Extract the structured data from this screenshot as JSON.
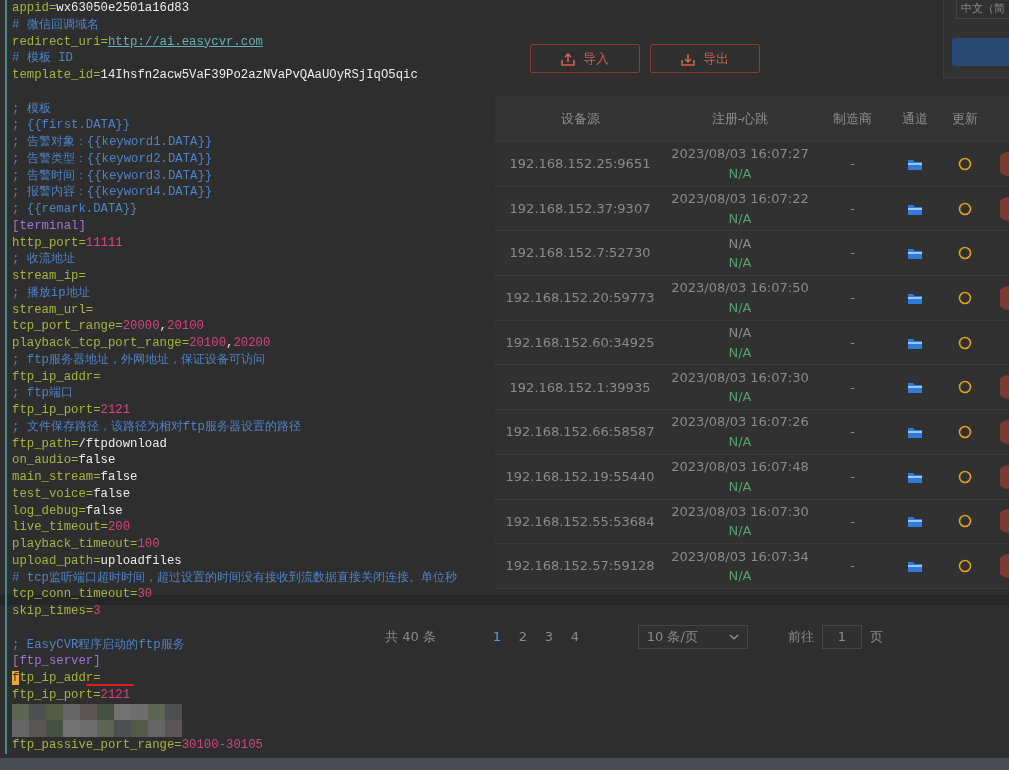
{
  "editor": {
    "lines": [
      {
        "kind": "code",
        "tokens": [
          {
            "kind": "key",
            "text": "appid="
          },
          {
            "kind": "value",
            "text": "wx63050e2501a16d83"
          }
        ]
      },
      {
        "kind": "code",
        "tokens": [
          {
            "kind": "comment",
            "text": "# 微信回调域名"
          }
        ]
      },
      {
        "kind": "code",
        "tokens": [
          {
            "kind": "key",
            "text": "redirect_uri="
          },
          {
            "kind": "url",
            "text": "http://ai.easycvr.com"
          }
        ]
      },
      {
        "kind": "code",
        "tokens": [
          {
            "kind": "comment",
            "text": "# 模板 ID"
          }
        ]
      },
      {
        "kind": "code",
        "tokens": [
          {
            "kind": "key",
            "text": "template_id="
          },
          {
            "kind": "value",
            "text": "14Ihsfn2acw5VaF39Po2azNVaPvQAaUOyRSjIqO5qic"
          }
        ]
      },
      {
        "kind": "blank"
      },
      {
        "kind": "code",
        "tokens": [
          {
            "kind": "comment",
            "text": "; 模板"
          }
        ]
      },
      {
        "kind": "code",
        "tokens": [
          {
            "kind": "comment",
            "text": "; {{first.DATA}}"
          }
        ]
      },
      {
        "kind": "code",
        "tokens": [
          {
            "kind": "comment",
            "text": "; 告警对象：{{keyword1.DATA}}"
          }
        ]
      },
      {
        "kind": "code",
        "tokens": [
          {
            "kind": "comment",
            "text": "; 告警类型：{{keyword2.DATA}}"
          }
        ]
      },
      {
        "kind": "code",
        "tokens": [
          {
            "kind": "comment",
            "text": "; 告警时间：{{keyword3.DATA}}"
          }
        ]
      },
      {
        "kind": "code",
        "tokens": [
          {
            "kind": "comment",
            "text": "; 报警内容：{{keyword4.DATA}}"
          }
        ]
      },
      {
        "kind": "code",
        "tokens": [
          {
            "kind": "comment",
            "text": "; {{remark.DATA}}"
          }
        ]
      },
      {
        "kind": "code",
        "tokens": [
          {
            "kind": "section",
            "text": "[terminal]"
          }
        ]
      },
      {
        "kind": "code",
        "tokens": [
          {
            "kind": "key",
            "text": "http_port="
          },
          {
            "kind": "number",
            "text": "11111"
          }
        ]
      },
      {
        "kind": "code",
        "tokens": [
          {
            "kind": "comment",
            "text": "; 收流地址"
          }
        ]
      },
      {
        "kind": "code",
        "tokens": [
          {
            "kind": "key",
            "text": "stream_ip="
          }
        ]
      },
      {
        "kind": "code",
        "tokens": [
          {
            "kind": "comment",
            "text": "; 播放ip地址"
          }
        ]
      },
      {
        "kind": "code",
        "tokens": [
          {
            "kind": "key",
            "text": "stream_url="
          }
        ]
      },
      {
        "kind": "code",
        "tokens": [
          {
            "kind": "key",
            "text": "tcp_port_range="
          },
          {
            "kind": "number",
            "text": "20000"
          },
          {
            "kind": "value",
            "text": ","
          },
          {
            "kind": "number",
            "text": "20100"
          }
        ]
      },
      {
        "kind": "code",
        "tokens": [
          {
            "kind": "key",
            "text": "playback_tcp_port_range="
          },
          {
            "kind": "number",
            "text": "20100"
          },
          {
            "kind": "value",
            "text": ","
          },
          {
            "kind": "number",
            "text": "20200"
          }
        ]
      },
      {
        "kind": "code",
        "tokens": [
          {
            "kind": "comment",
            "text": "; ftp服务器地址，外网地址，保证设备可访问"
          }
        ]
      },
      {
        "kind": "code",
        "tokens": [
          {
            "kind": "key",
            "text": "ftp_ip_addr="
          }
        ]
      },
      {
        "kind": "code",
        "tokens": [
          {
            "kind": "comment",
            "text": "; ftp端口"
          }
        ]
      },
      {
        "kind": "code",
        "tokens": [
          {
            "kind": "key",
            "text": "ftp_ip_port="
          },
          {
            "kind": "number",
            "text": "2121"
          }
        ]
      },
      {
        "kind": "code",
        "tokens": [
          {
            "kind": "comment",
            "text": "; 文件保存路径，该路径为相对ftp服务器设置的路径"
          }
        ]
      },
      {
        "kind": "code",
        "tokens": [
          {
            "kind": "key",
            "text": "ftp_path="
          },
          {
            "kind": "value",
            "text": "/ftpdownload"
          }
        ]
      },
      {
        "kind": "code",
        "tokens": [
          {
            "kind": "key",
            "text": "on_audio="
          },
          {
            "kind": "value",
            "text": "false"
          }
        ]
      },
      {
        "kind": "code",
        "tokens": [
          {
            "kind": "key",
            "text": "main_stream="
          },
          {
            "kind": "value",
            "text": "false"
          }
        ]
      },
      {
        "kind": "code",
        "tokens": [
          {
            "kind": "key",
            "text": "test_voice="
          },
          {
            "kind": "value",
            "text": "false"
          }
        ]
      },
      {
        "kind": "code",
        "tokens": [
          {
            "kind": "key",
            "text": "log_debug="
          },
          {
            "kind": "value",
            "text": "false"
          }
        ]
      },
      {
        "kind": "code",
        "tokens": [
          {
            "kind": "key",
            "text": "live_timeout="
          },
          {
            "kind": "number",
            "text": "200"
          }
        ]
      },
      {
        "kind": "code",
        "tokens": [
          {
            "kind": "key",
            "text": "playback_timeout="
          },
          {
            "kind": "number",
            "text": "100"
          }
        ]
      },
      {
        "kind": "code",
        "tokens": [
          {
            "kind": "key",
            "text": "upload_path="
          },
          {
            "kind": "value",
            "text": "uploadfiles"
          }
        ]
      },
      {
        "kind": "code",
        "tokens": [
          {
            "kind": "comment",
            "text": "# tcp监听端口超时时间，超过设置的时间没有接收到流数据直接关闭连接。单位秒"
          }
        ]
      },
      {
        "kind": "code",
        "tokens": [
          {
            "kind": "key",
            "text": "tcp_conn_timeout="
          },
          {
            "kind": "number",
            "text": "30"
          }
        ]
      },
      {
        "kind": "code",
        "tokens": [
          {
            "kind": "key",
            "text": "skip_times="
          },
          {
            "kind": "number",
            "text": "3"
          }
        ]
      },
      {
        "kind": "blank"
      },
      {
        "kind": "code",
        "tokens": [
          {
            "kind": "comment",
            "text": "; EasyCVR程序启动的ftp服务"
          }
        ]
      },
      {
        "kind": "code",
        "tokens": [
          {
            "kind": "section",
            "text": "[ftp_server]"
          }
        ]
      },
      {
        "kind": "code",
        "tokens": [
          {
            "kind": "cursor",
            "text": "f"
          },
          {
            "kind": "key",
            "text": "tp_ip_add"
          },
          {
            "kind": "key",
            "text": "r=",
            "marked": true
          }
        ]
      },
      {
        "kind": "code",
        "tokens": [
          {
            "kind": "key",
            "text": "ftp_ip_port="
          },
          {
            "kind": "number",
            "text": "2121"
          }
        ]
      },
      {
        "kind": "redacted"
      },
      {
        "kind": "redacted"
      },
      {
        "kind": "code",
        "tokens": [
          {
            "kind": "key",
            "text": "ftp_passive_port_range="
          },
          {
            "kind": "number",
            "text": "30100-30105"
          }
        ]
      }
    ]
  },
  "app": {
    "language_select": "中文（简",
    "buttons": [
      {
        "label": "导入"
      },
      {
        "label": "导出"
      }
    ],
    "table": {
      "columns": [
        "设备源",
        "注册-心跳",
        "制造商",
        "通道",
        "更新"
      ],
      "rows": [
        {
          "source": "192.168.152.25:9651",
          "register": "2023/08/03 16:07:27",
          "heartbeat": "N/A",
          "maker": "-",
          "online": true
        },
        {
          "source": "192.168.152.37:9307",
          "register": "2023/08/03 16:07:22",
          "heartbeat": "N/A",
          "maker": "-",
          "online": true
        },
        {
          "source": "192.168.152.7:52730",
          "register": "N/A",
          "heartbeat": "N/A",
          "maker": "-",
          "online": false
        },
        {
          "source": "192.168.152.20:59773",
          "register": "2023/08/03 16:07:50",
          "heartbeat": "N/A",
          "maker": "-",
          "online": true
        },
        {
          "source": "192.168.152.60:34925",
          "register": "N/A",
          "heartbeat": "N/A",
          "maker": "-",
          "online": false
        },
        {
          "source": "192.168.152.1:39935",
          "register": "2023/08/03 16:07:30",
          "heartbeat": "N/A",
          "maker": "-",
          "online": true
        },
        {
          "source": "192.168.152.66:58587",
          "register": "2023/08/03 16:07:26",
          "heartbeat": "N/A",
          "maker": "-",
          "online": true
        },
        {
          "source": "192.168.152.19:55440",
          "register": "2023/08/03 16:07:48",
          "heartbeat": "N/A",
          "maker": "-",
          "online": true
        },
        {
          "source": "192.168.152.55:53684",
          "register": "2023/08/03 16:07:30",
          "heartbeat": "N/A",
          "maker": "-",
          "online": true
        },
        {
          "source": "192.168.152.57:59128",
          "register": "2023/08/03 16:07:34",
          "heartbeat": "N/A",
          "maker": "-",
          "online": true
        }
      ]
    },
    "pagination": {
      "total": "共 40 条",
      "pages": [
        {
          "label": "1",
          "selected": true
        },
        {
          "label": "2",
          "selected": false
        },
        {
          "label": "3",
          "selected": false
        },
        {
          "label": "4",
          "selected": false
        }
      ],
      "page_size": "10 条/页",
      "goto_label": "前往",
      "goto_value": "1",
      "goto_suffix": "页"
    }
  }
}
